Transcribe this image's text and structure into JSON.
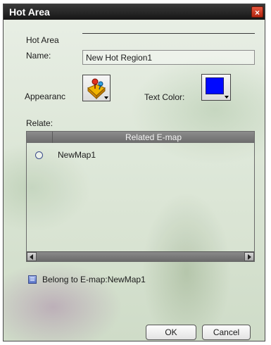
{
  "dialog": {
    "title": "Hot Area",
    "close_label": "×"
  },
  "form": {
    "hot_area_label": "Hot Area",
    "name_label": "Name:",
    "name_value": "New Hot Region1",
    "appearance_label": "Appearanc",
    "text_color_label": "Text Color:",
    "text_color": "#0008ff",
    "relate_label": "Relate:"
  },
  "table": {
    "column_header": "Related E-map",
    "rows": [
      {
        "label": "NewMap1",
        "selected": false
      }
    ]
  },
  "belong": {
    "label": "Belong to E-map:NewMap1"
  },
  "buttons": {
    "ok": "OK",
    "cancel": "Cancel"
  }
}
